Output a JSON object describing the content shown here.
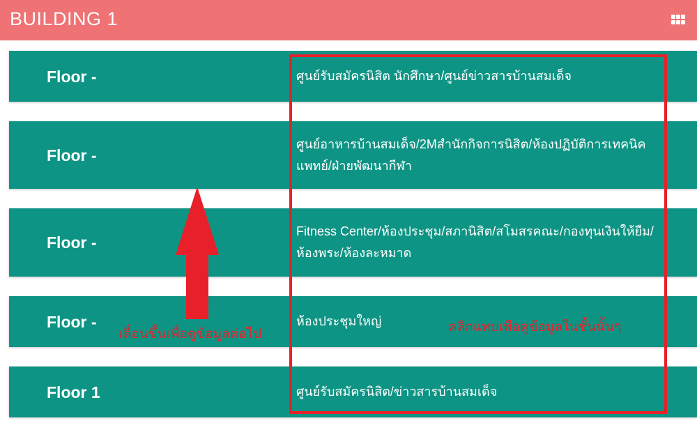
{
  "header": {
    "title": "BUILDING 1",
    "menu_icon": "grid-icon"
  },
  "floors": [
    {
      "label": "Floor -",
      "description": "ศูนย์รับสมัครนิสิต นักศึกษา/ศูนย์ข่าวสารบ้านสมเด็จ"
    },
    {
      "label": "Floor -",
      "description": "ศูนย์อาหารบ้านสมเด็จ/2Mสำนักกิจการนิสิต/ห้องปฏิบัติการเทคนิคแพทย์/ฝ่ายพัฒนากีฬา"
    },
    {
      "label": "Floor -",
      "description": "Fitness Center/ห้องประชุม/สภานิสิต/สโมสรคณะ/กองทุนเงินให้ยืม/ห้องพระ/ห้องละหมาด"
    },
    {
      "label": "Floor -",
      "description": "ห้องประชุมใหญ่"
    },
    {
      "label": "Floor 1",
      "description": "ศูนย์รับสมัครนิสิต/ข่าวสารบ้านสมเด็จ"
    }
  ],
  "annotations": {
    "scroll_hint": "เลื่อนขึ้นเพื่อดูข้อมูลต่อไป",
    "tap_hint": "คลิกแทบเพื่อดูข้อมูลในชั้นนั้นๆ"
  },
  "colors": {
    "header_bg": "#ef7275",
    "row_bg": "#0e9484",
    "annotation": "#e8202a"
  }
}
